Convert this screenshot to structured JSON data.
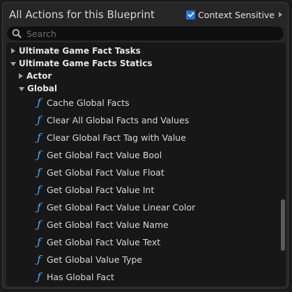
{
  "header": {
    "title": "All Actions for this Blueprint",
    "context_sensitive_label": "Context Sensitive",
    "context_sensitive_checked": true
  },
  "search": {
    "placeholder": "Search",
    "value": ""
  },
  "tree": {
    "categories": [
      {
        "label": "Ultimate Game Fact Tasks",
        "expanded": false
      },
      {
        "label": "Ultimate Game Facts Statics",
        "expanded": true
      },
      {
        "label": "Actor",
        "expanded": false
      },
      {
        "label": "Global",
        "expanded": true
      }
    ],
    "actions": [
      {
        "label": "Cache Global Facts",
        "icon": "function-icon"
      },
      {
        "label": "Clear All Global Facts and Values",
        "icon": "function-icon"
      },
      {
        "label": "Clear Global Fact Tag with Value",
        "icon": "function-icon"
      },
      {
        "label": "Get Global Fact Value Bool",
        "icon": "function-icon"
      },
      {
        "label": "Get Global Fact Value Float",
        "icon": "function-icon"
      },
      {
        "label": "Get Global Fact Value Int",
        "icon": "function-icon"
      },
      {
        "label": "Get Global Fact Value Linear Color",
        "icon": "function-icon"
      },
      {
        "label": "Get Global Fact Value Name",
        "icon": "function-icon"
      },
      {
        "label": "Get Global Fact Value Text",
        "icon": "function-icon"
      },
      {
        "label": "Get Global Value Type",
        "icon": "function-icon"
      },
      {
        "label": "Has Global Fact",
        "icon": "function-icon"
      }
    ]
  },
  "colors": {
    "accent": "#2a74d5",
    "function_icon": "#4ea8ff"
  }
}
